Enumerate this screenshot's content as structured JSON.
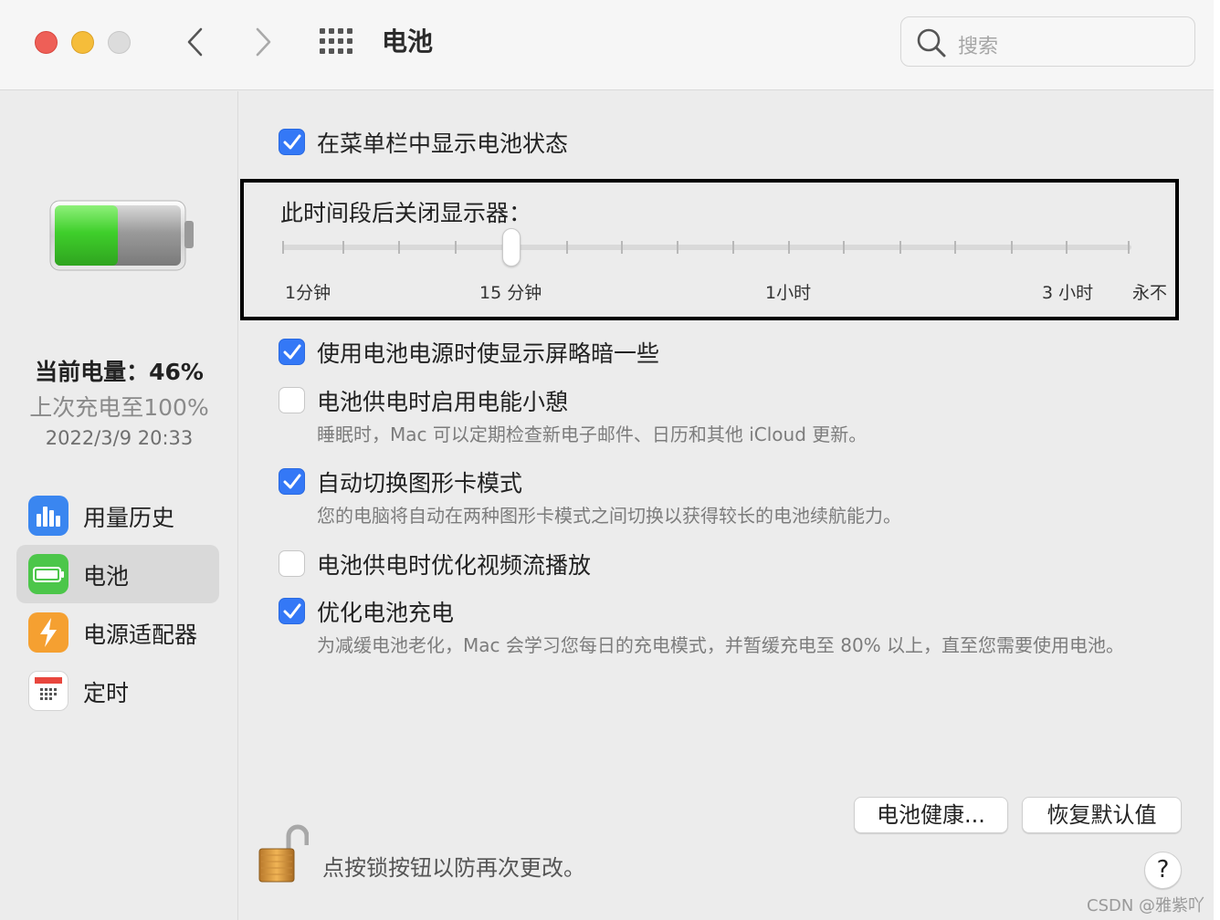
{
  "window": {
    "title": "电池",
    "search_placeholder": "搜索"
  },
  "sidebar": {
    "current_charge": "当前电量：46%",
    "last_charged": "上次充电至100%",
    "last_charged_time": "2022/3/9 20:33",
    "battery_level": 0.46,
    "items": [
      {
        "label": "用量历史",
        "icon": "usage-history-icon",
        "selected": false
      },
      {
        "label": "电池",
        "icon": "battery-icon",
        "selected": true
      },
      {
        "label": "电源适配器",
        "icon": "power-adapter-icon",
        "selected": false
      },
      {
        "label": "定时",
        "icon": "schedule-icon",
        "selected": false
      }
    ]
  },
  "main": {
    "show_in_menu_bar": {
      "label": "在菜单栏中显示电池状态",
      "checked": true
    },
    "display_off": {
      "title": "此时间段后关闭显示器：",
      "labels": [
        "1分钟",
        "15 分钟",
        "1小时",
        "3 小时",
        "永不"
      ],
      "value": "15 分钟"
    },
    "options": [
      {
        "label": "使用电池电源时使显示屏略暗一些",
        "checked": true,
        "desc": ""
      },
      {
        "label": "电池供电时启用电能小憩",
        "checked": false,
        "desc": "睡眠时，Mac 可以定期检查新电子邮件、日历和其他 iCloud 更新。"
      },
      {
        "label": "自动切换图形卡模式",
        "checked": true,
        "desc": "您的电脑将自动在两种图形卡模式之间切换以获得较长的电池续航能力。"
      },
      {
        "label": "电池供电时优化视频流播放",
        "checked": false,
        "desc": ""
      },
      {
        "label": "优化电池充电",
        "checked": true,
        "desc": "为减缓电池老化，Mac 会学习您每日的充电模式，并暂缓充电至 80% 以上，直至您需要使用电池。"
      }
    ],
    "battery_health_button": "电池健康...",
    "restore_defaults_button": "恢复默认值",
    "lock_text": "点按锁按钮以防再次更改。",
    "help_label": "?"
  },
  "watermark": "CSDN @雅紫吖",
  "colors": {
    "accent": "#3478f6",
    "battery_green": "#3fcf2b"
  }
}
